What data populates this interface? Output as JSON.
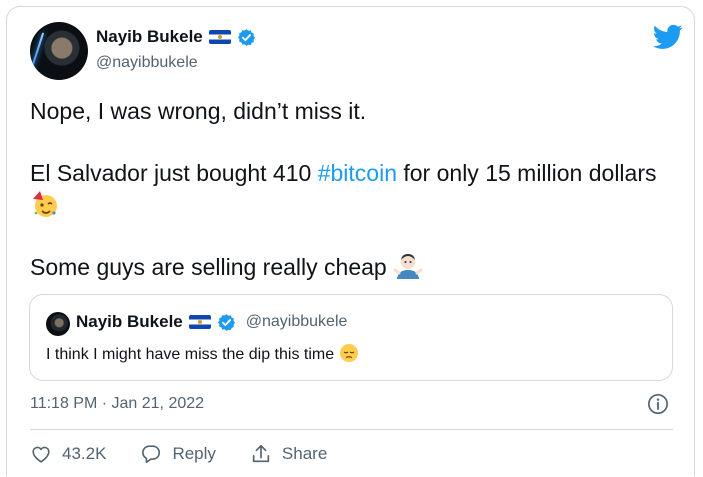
{
  "author": {
    "name": "Nayib Bukele",
    "handle": "@nayibbukele",
    "avatar_icon": "avatar",
    "flag_icon": "el-salvador-flag-icon",
    "verified_icon": "verified-badge-icon"
  },
  "tweet": {
    "line1": "Nope, I was wrong, didn’t miss it.",
    "line2_pre": "El Salvador just bought 410 ",
    "hashtag": "#bitcoin",
    "line2_post": " for only 15 million dollars",
    "line2_emoji": "partying-face-emoji",
    "line3": "Some guys are selling really cheap",
    "line3_emoji": "man-shrugging-emoji"
  },
  "quoted": {
    "name": "Nayib Bukele",
    "handle": "@nayibbukele",
    "text": "I think I might have miss the dip this time",
    "emoji": "pensive-face-emoji"
  },
  "meta": {
    "timestamp": "11:18 PM · Jan 21, 2022"
  },
  "actions": {
    "like_count": "43.2K",
    "reply_label": "Reply",
    "share_label": "Share"
  },
  "colors": {
    "link": "#1d9bf0",
    "muted": "#536471",
    "border": "#cfd9de",
    "verified": "#1d9bf0",
    "twitter_blue": "#1d9bf0"
  }
}
